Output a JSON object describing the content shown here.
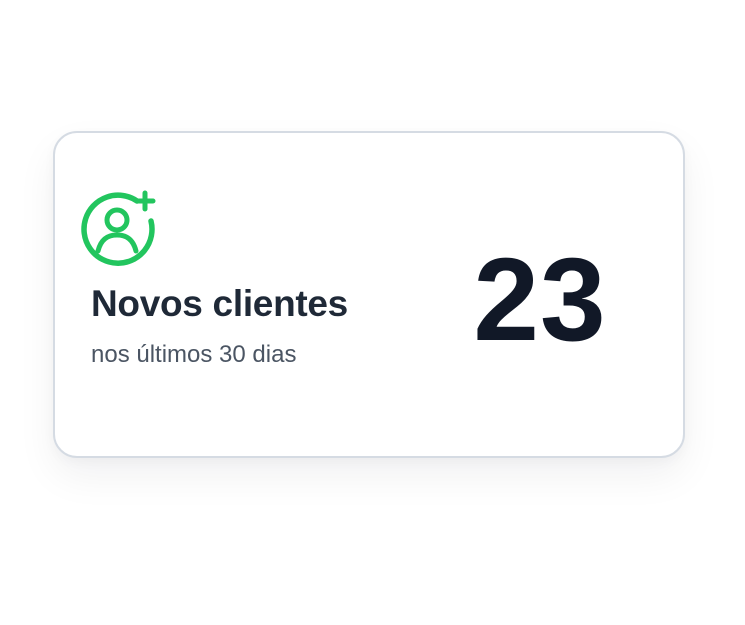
{
  "card": {
    "icon": "user-plus-icon",
    "accent_color": "#22c55e",
    "title": "Novos clientes",
    "subtitle": "nos últimos 30 dias",
    "value": "23"
  }
}
